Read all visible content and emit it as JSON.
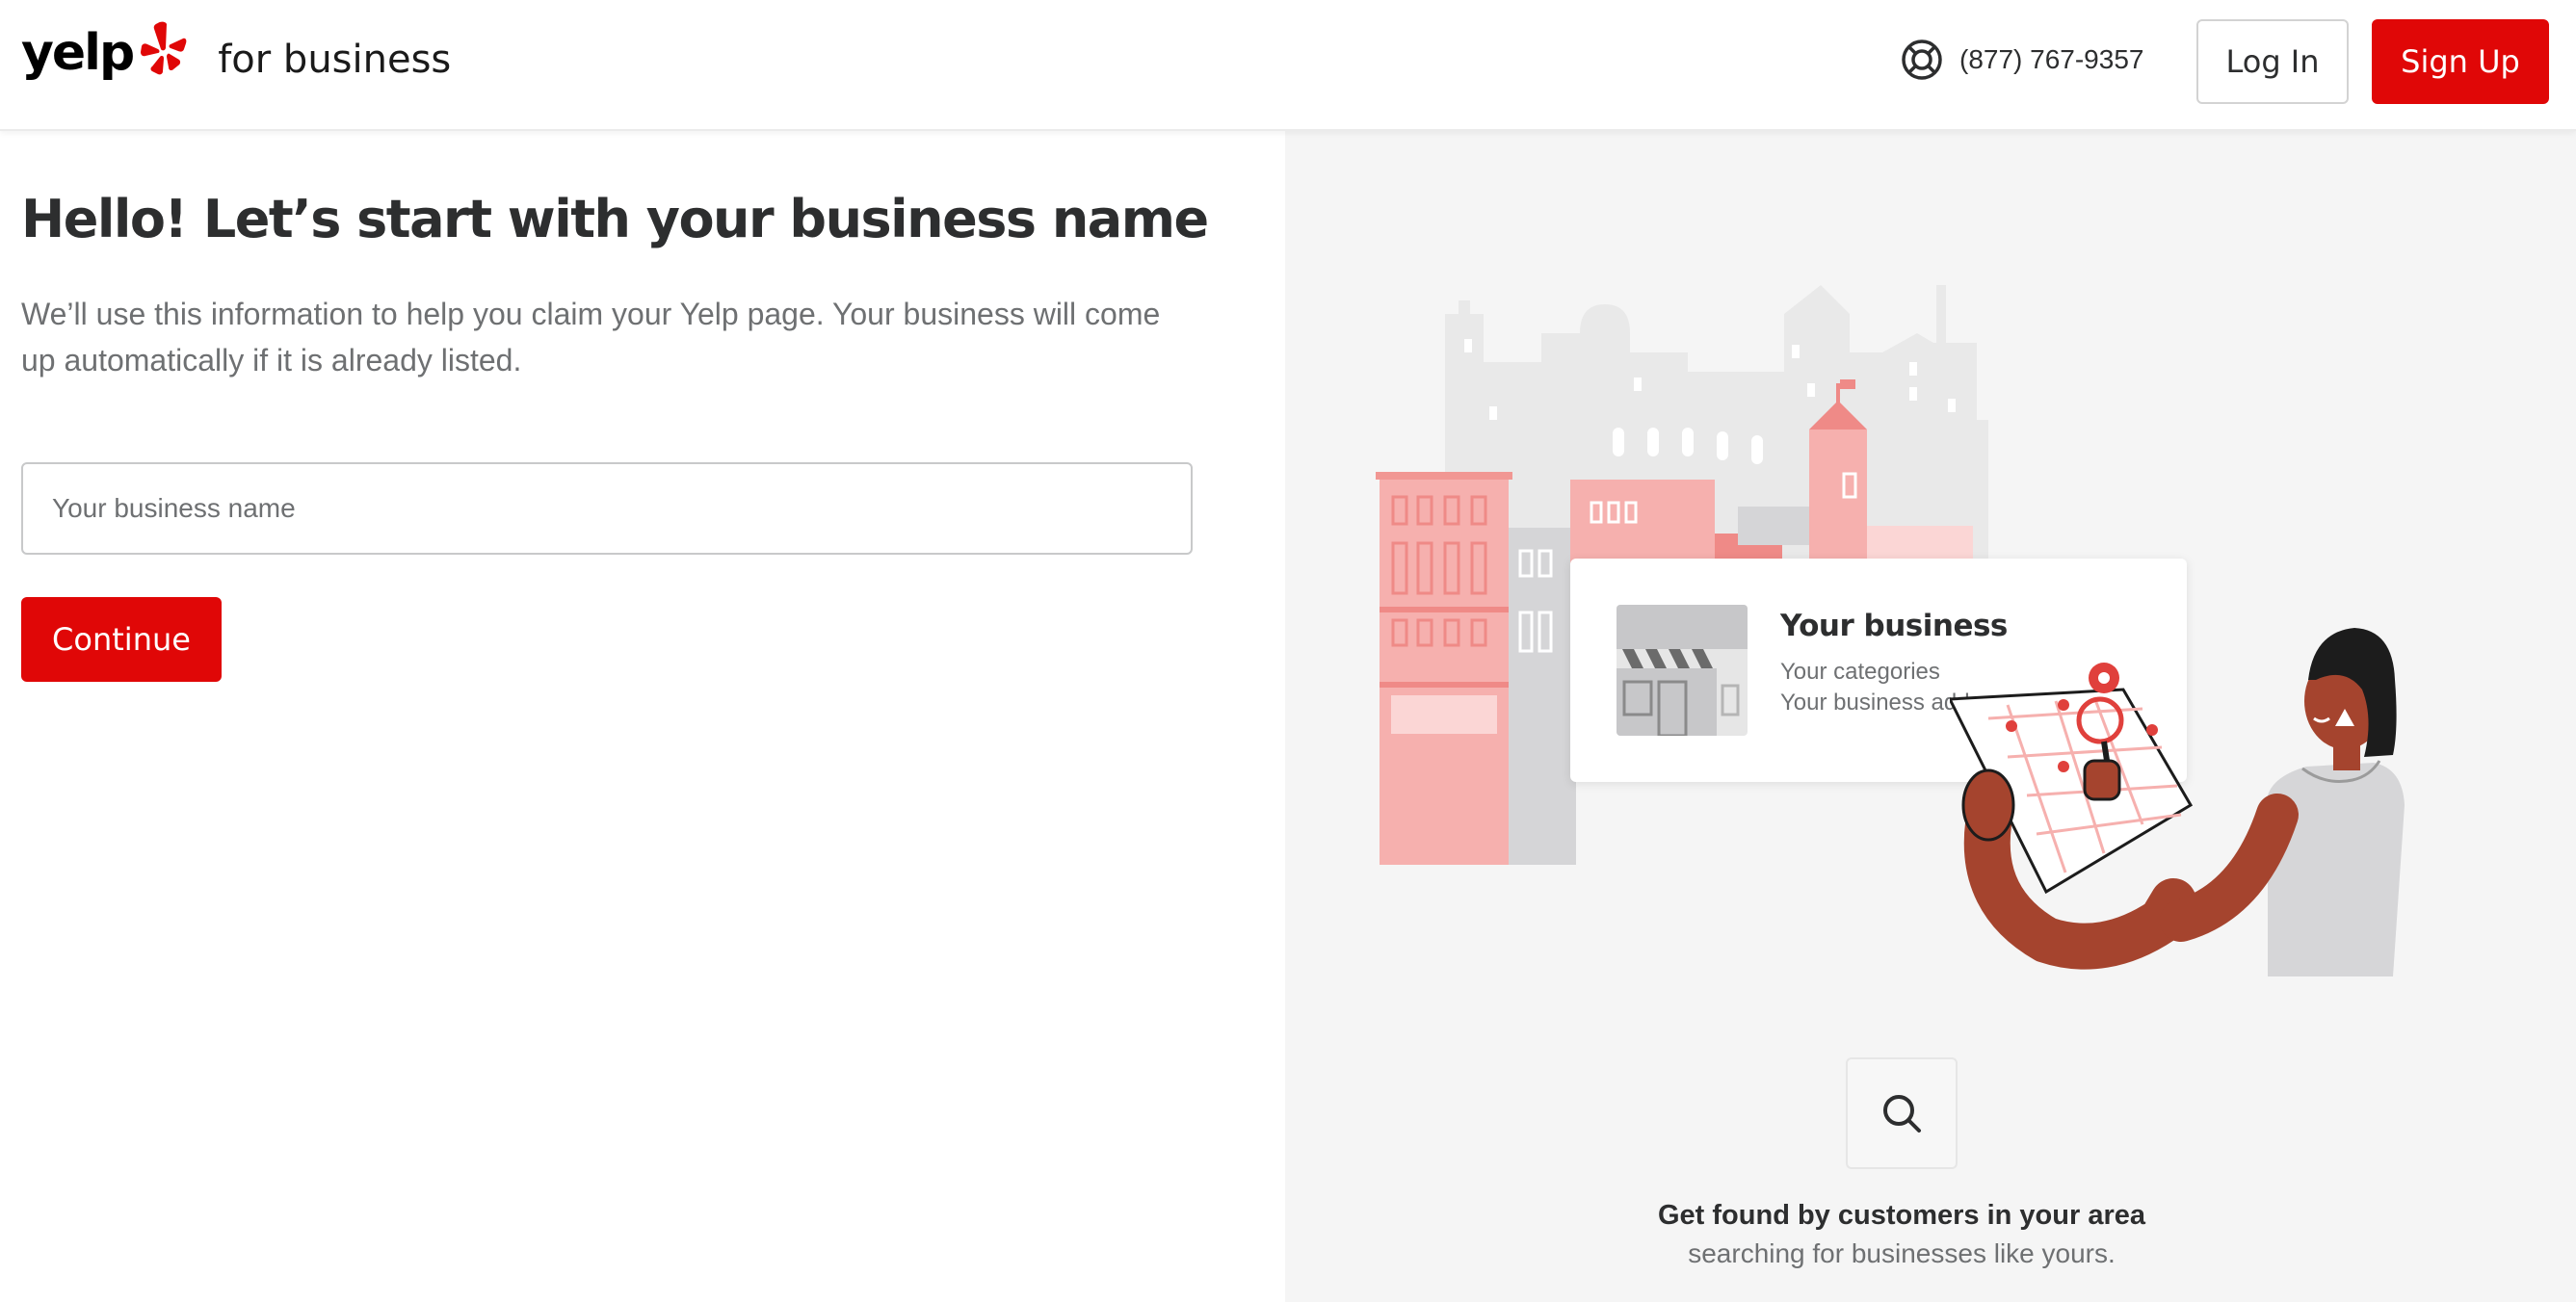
{
  "header": {
    "logo_text": "yelp",
    "logo_sub": "for business",
    "phone": "(877) 767-9357",
    "login_label": "Log In",
    "signup_label": "Sign Up"
  },
  "form": {
    "title": "Hello! Let’s start with your business name",
    "subtitle": "We’ll use this information to help you claim your Yelp page. Your business will come up automatically if it is already listed.",
    "input_placeholder": "Your business name",
    "input_value": "",
    "continue_label": "Continue"
  },
  "preview": {
    "business_name": "Your business",
    "categories": "Your categories",
    "address": "Your business address"
  },
  "promo": {
    "icon": "search-icon",
    "title": "Get found by customers in your area",
    "subtitle": "searching for businesses like yours."
  },
  "colors": {
    "brand_red": "#e00707",
    "panel_bg": "#f5f5f5",
    "text_dark": "#2d2e2f",
    "text_muted": "#6e7072"
  }
}
